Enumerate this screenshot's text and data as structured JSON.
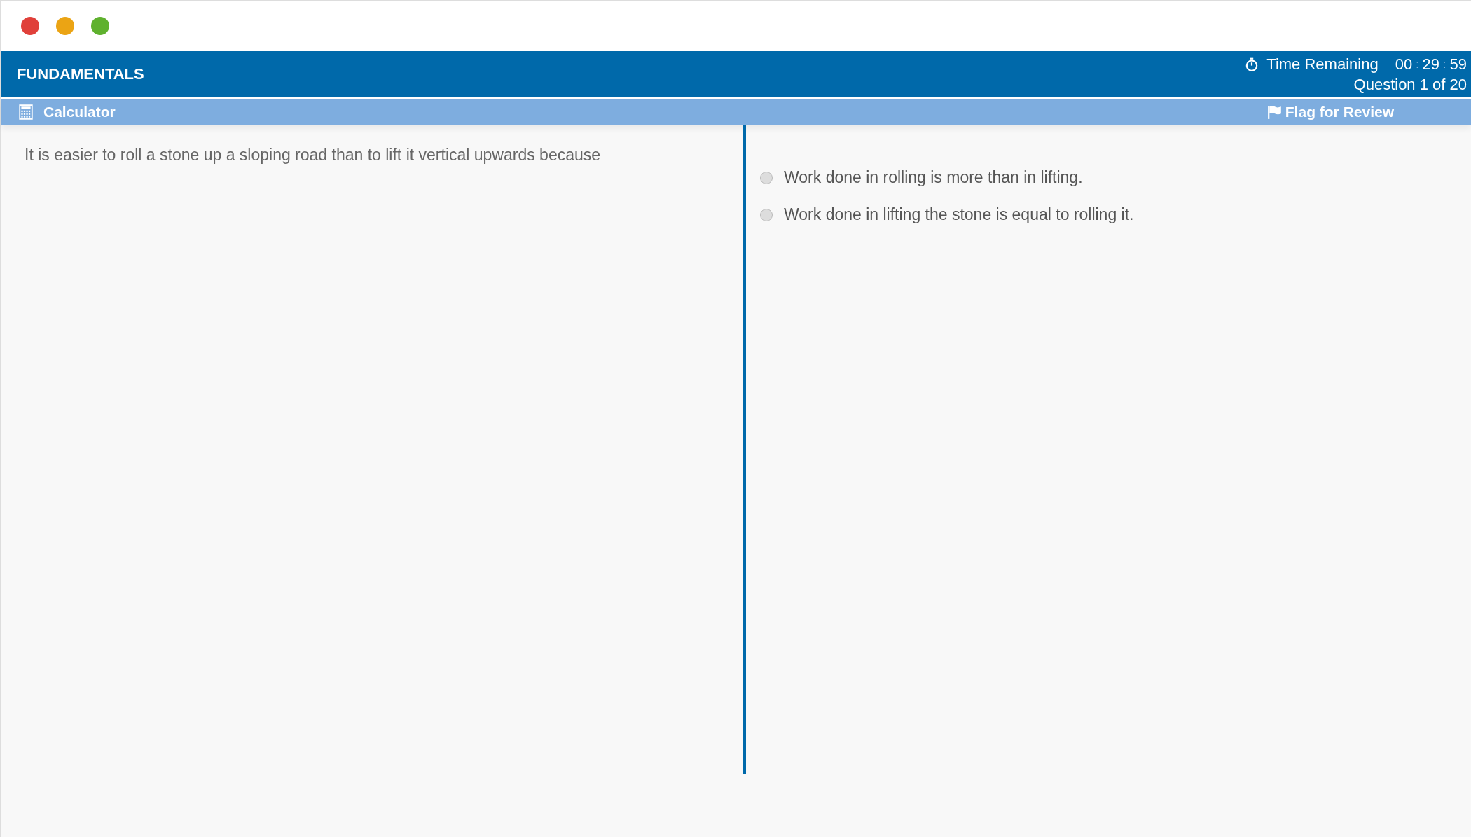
{
  "header": {
    "title": "FUNDAMENTALS",
    "timer_label": "Time Remaining",
    "timer_parts": [
      {
        "kind": "digits",
        "text": "00"
      },
      {
        "kind": "separator",
        "text": ":"
      },
      {
        "kind": "digits",
        "text": "29"
      },
      {
        "kind": "separator",
        "text": ":"
      },
      {
        "kind": "digits",
        "text": "59"
      }
    ],
    "progress": "Question 1 of 20"
  },
  "toolbar": {
    "calculator": "Calculator",
    "flag": "Flag for Review"
  },
  "question": "It is easier to roll a stone up a sloping road than to lift it vertical upwards because",
  "options": [
    {
      "label": "Work done in rolling is more than in lifting.",
      "selected": false
    },
    {
      "label": "Work done in lifting the stone is equal to rolling it.",
      "selected": false
    }
  ]
}
